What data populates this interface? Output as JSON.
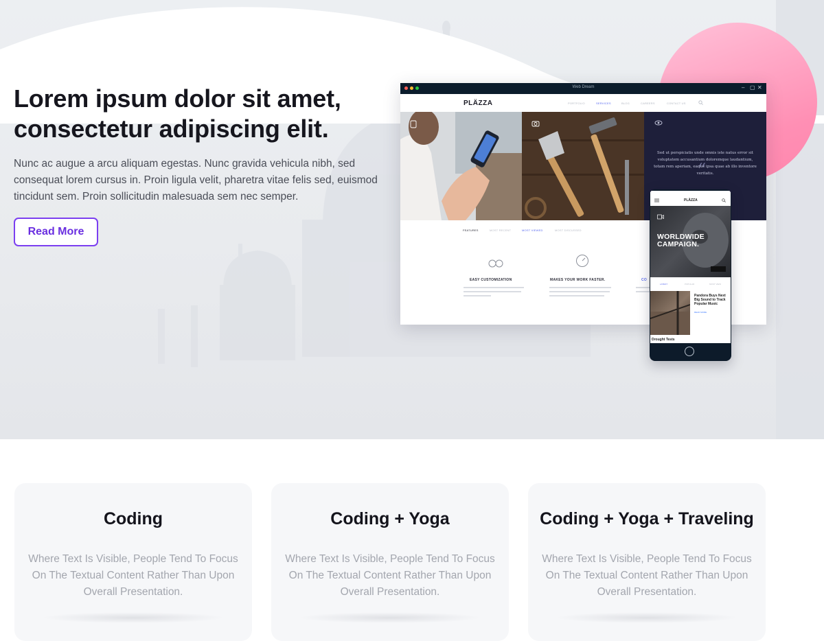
{
  "hero": {
    "title": "Lorem ipsum dolor sit amet, consectetur adipiscing elit.",
    "text": "Nunc ac augue a arcu aliquam egestas. Nunc gravida vehicula nibh, sed consequat lorem cursus in. Proin ligula velit, pharetra vitae felis sed, euismod tincidunt sem. Proin sollicitudin malesuada sem nec semper.",
    "button_label": "Read More"
  },
  "mockup": {
    "window_title": "Web Dream",
    "logo": "PLÄZZA",
    "nav_items": [
      "PORTFOLIO",
      "SERVICES",
      "BLOG",
      "CAREERS",
      "CONTACT US"
    ],
    "active_nav": "SERVICES",
    "quote": "Sed ut perspiciatis unde omnis iste natus error sit voluptatem accusantium doloremque laudantium, totam rem aperiam, eaque ipsa quae ab illo inventore veritatis.",
    "tabs": [
      "FEATURES",
      "MOST RECENT",
      "MOST VIEWED",
      "MOST DISCUSSED"
    ],
    "active_tab": "MOST VIEWED",
    "features": [
      "EASY CUSTOMIZATION",
      "MAKES YOUR WORK FASTER.",
      "CO"
    ],
    "phone": {
      "logo": "PLÄZZA",
      "hero_title": "WORLDWIDE CAMPAIGN.",
      "tabs": [
        "LATEST",
        "POPULAR",
        "MOST VIEW"
      ],
      "card_title": "Pandora Buys Next Big Sound to Track Popular Music",
      "card_meta": "READ MORE",
      "card2_title": "Drought Tests"
    }
  },
  "cards": [
    {
      "title": "Coding",
      "text": "Where Text Is Visible, People Tend To Focus On The Textual Content Rather Than Upon Overall Presentation."
    },
    {
      "title": "Coding + Yoga",
      "text": "Where Text Is Visible, People Tend To Focus On The Textual Content Rather Than Upon Overall Presentation."
    },
    {
      "title": "Coding + Yoga + Traveling",
      "text": "Where Text Is Visible, People Tend To Focus On The Textual Content Rather Than Upon Overall Presentation."
    }
  ],
  "colors": {
    "accent": "#7b3ef0",
    "pink": "#ff8fb4",
    "heading": "#16161e",
    "muted_text": "#a3a6ae"
  }
}
